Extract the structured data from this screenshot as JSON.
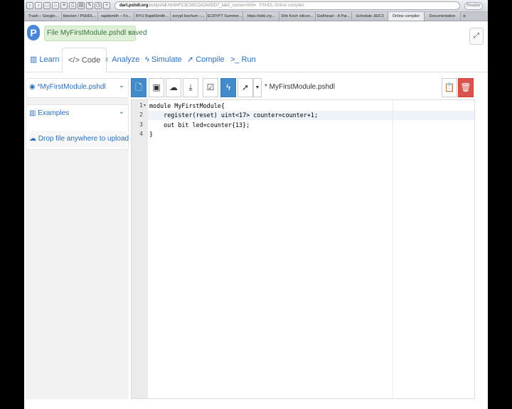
{
  "browser": {
    "url_host": "dart.pshdl.org",
    "url_rest": "/out/pshdl.html#FC3C30CDA2A0DD7_tab2_cursor=0#0=",
    "page_title": "PSHDL Online compiler",
    "reader_label": "Reader",
    "tabs": [
      "Trash – Google...",
      "kbecker / PSHDL...",
      "rapidsmith – Fo...",
      "BYU RapidSmith...",
      "ecrypt bochum –...",
      "ECRYPT Summer...",
      "https://wiki.cry...",
      "Dirk Koch silicon...",
      "GoAhead – A Par...",
      "Schedule JEIC3",
      "Online compiler",
      "Documentation"
    ]
  },
  "header": {
    "logo_letter": "P",
    "toast_text": "File MyFirstModule.pshdl saved",
    "toast_close": "×",
    "right_button_icon": "expand-icon"
  },
  "nav": {
    "tabs": [
      {
        "label": "Learn",
        "icon": "book-icon"
      },
      {
        "label": "Code",
        "icon": "code-icon"
      },
      {
        "label": "Analyze",
        "icon": "stethoscope-icon"
      },
      {
        "label": "Simulate",
        "icon": "bolt-icon"
      },
      {
        "label": "Compile",
        "icon": "rocket-icon"
      },
      {
        "label": "Run",
        "icon": "terminal-icon"
      }
    ],
    "active": "Code"
  },
  "sidebar": {
    "file_label": "*MyFirstModule.pshdl",
    "examples_label": "Examples",
    "upload_label": "Drop file anywhere to upload"
  },
  "editor_toolbar": {
    "open_file": "* MyFirstModule.pshdl",
    "buttons": [
      "new-file-icon",
      "save-icon",
      "cloud-upload-icon",
      "download-icon",
      "check-icon",
      "bolt-icon",
      "rocket-icon",
      "clipboard-icon",
      "trash-icon"
    ]
  },
  "editor": {
    "line_numbers": [
      "1",
      "2",
      "3",
      "4"
    ],
    "lines": [
      "module MyFirstModule{",
      "    register(reset) uint<17> counter=counter+1;",
      "    out bit led=counter{13};",
      "}"
    ]
  },
  "colors": {
    "accent": "#428bca",
    "link": "#2a6ebb",
    "toast_bg": "#dff0d8",
    "danger": "#d9534f"
  }
}
